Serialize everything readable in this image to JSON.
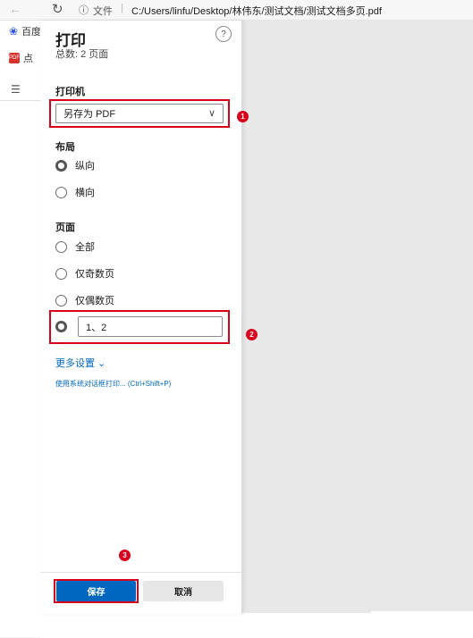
{
  "browser": {
    "file_label": "文件",
    "separator": "|",
    "address": "C:/Users/linfu/Desktop/林伟东/测试文档/测试文档多页.pdf"
  },
  "bookmarks": [
    {
      "label": "百度",
      "icon": "baidu-icon"
    },
    {
      "label": "点",
      "icon": "pdf-icon"
    }
  ],
  "print": {
    "title": "打印",
    "total": "总数: 2 页面",
    "help_label": "?",
    "printer_section": "打印机",
    "printer_value": "另存为 PDF",
    "layout_section": "布局",
    "layout_options": [
      {
        "label": "纵向",
        "checked": true
      },
      {
        "label": "横向",
        "checked": false
      }
    ],
    "pages_section": "页面",
    "pages_options": [
      {
        "label": "全部",
        "checked": false
      },
      {
        "label": "仅奇数页",
        "checked": false
      },
      {
        "label": "仅偶数页",
        "checked": false
      }
    ],
    "custom_pages_value": "1、2",
    "more_settings": "更多设置 ⌄",
    "system_dialog": "使用系统对话框打印... (Ctrl+Shift+P)",
    "save_label": "保存",
    "cancel_label": "取消"
  },
  "annotations": {
    "marker_1": "1",
    "marker_2": "2",
    "marker_3": "3",
    "color": "#d9001b"
  }
}
